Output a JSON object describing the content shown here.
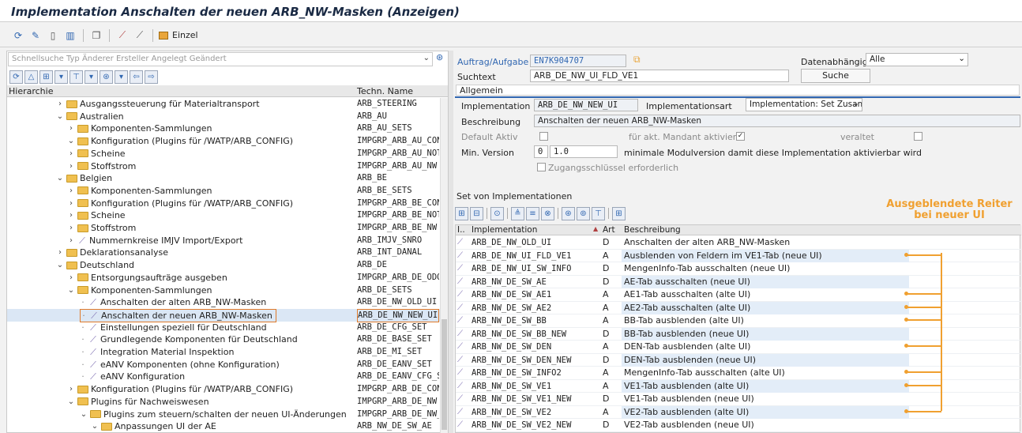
{
  "window": {
    "title": "Implementation Anschalten der neuen ARB_NW-Masken (Anzeigen)"
  },
  "toolbar": {
    "einzel_label": "Einzel"
  },
  "left": {
    "search_placeholder": "Schnellsuche Typ Änderer Ersteller Angelegt Geändert",
    "col_hierarchy": "Hierarchie",
    "col_tech": "Techn. Name",
    "rows": [
      {
        "label": "Ausgangssteuerung für Materialtransport",
        "tech": "ARB_STEERING"
      },
      {
        "label": "Australien",
        "tech": "ARB_AU"
      },
      {
        "label": "Komponenten-Sammlungen",
        "tech": "ARB_AU_SETS"
      },
      {
        "label": "Konfiguration (Plugins für /WATP/ARB_CONFIG)",
        "tech": "IMPGRP_ARB_AU_CON"
      },
      {
        "label": "Scheine",
        "tech": "IMPGRP_ARB_AU_NOT"
      },
      {
        "label": "Stoffstrom",
        "tech": "IMPGRP_ARB_AU_NW"
      },
      {
        "label": "Belgien",
        "tech": "ARB_BE"
      },
      {
        "label": "Komponenten-Sammlungen",
        "tech": "ARB_BE_SETS"
      },
      {
        "label": "Konfiguration (Plugins für /WATP/ARB_CONFIG)",
        "tech": "IMPGRP_ARB_BE_CONF"
      },
      {
        "label": "Scheine",
        "tech": "IMPGRP_ARB_BE_NOTI"
      },
      {
        "label": "Stoffstrom",
        "tech": "IMPGRP_ARB_BE_NW"
      },
      {
        "label": "Nummernkreise IMJV Import/Export",
        "tech": "ARB_IMJV_SNRO"
      },
      {
        "label": "Deklarationsanalyse",
        "tech": "ARB_INT_DANAL"
      },
      {
        "label": "Deutschland",
        "tech": "ARB_DE"
      },
      {
        "label": "Entsorgungsaufträge ausgeben",
        "tech": "IMPGRP_ARB_DE_ODO"
      },
      {
        "label": "Komponenten-Sammlungen",
        "tech": "ARB_DE_SETS"
      },
      {
        "label": "Anschalten der alten ARB_NW-Masken",
        "tech": "ARB_DE_NW_OLD_UI"
      },
      {
        "label": "Anschalten der neuen ARB_NW-Masken",
        "tech": "ARB_DE_NW_NEW_UI"
      },
      {
        "label": "Einstellungen speziell für Deutschland",
        "tech": "ARB_DE_CFG_SET"
      },
      {
        "label": "Grundlegende Komponenten für Deutschland",
        "tech": "ARB_DE_BASE_SET"
      },
      {
        "label": "Integration Material Inspektion",
        "tech": "ARB_DE_MI_SET"
      },
      {
        "label": "eANV Komponenten (ohne Konfiguration)",
        "tech": "ARB_DE_EANV_SET"
      },
      {
        "label": "eANV Konfiguration",
        "tech": "ARB_DE_EANV_CFG_SI"
      },
      {
        "label": "Konfiguration (Plugins für /WATP/ARB_CONFIG)",
        "tech": "IMPGRP_ARB_DE_CONI"
      },
      {
        "label": "Plugins für Nachweiswesen",
        "tech": "IMPGRP_ARB_DE_NW"
      },
      {
        "label": "Plugins zum steuern/schalten der neuen UI-Änderungen",
        "tech": "IMPGRP_ARB_DE_NW_"
      },
      {
        "label": "Anpassungen UI der AE",
        "tech": "ARB_NW_DE_SW_AE"
      }
    ]
  },
  "right": {
    "auftrag_label": "Auftrag/Aufgabe",
    "auftrag_value": "EN7K904707",
    "datenabh_label": "Datenabhängig",
    "datenabh_value": "Alle",
    "suchtext_label": "Suchtext",
    "suchtext_value": "ARB_DE_NW_UI_FLD_VE1",
    "suche_button": "Suche",
    "tab_allgemein": "Allgemein",
    "impl_label": "Implementation",
    "impl_value": "ARB_DE_NW_NEW_UI",
    "implart_label": "Implementationsart",
    "implart_value": "Implementation: Set Zusam...",
    "beschr_label": "Beschreibung",
    "beschr_value": "Anschalten der neuen ARB_NW-Masken",
    "default_label": "Default Aktiv",
    "akt_mandant_label": "für akt. Mandant aktiviert?",
    "veraltet_label": "veraltet",
    "minver_label": "Min. Version",
    "minver_a": "0",
    "minver_b": "1.0",
    "minver_text": "minimale Modulversion damit diese Implementation aktivierbar wird",
    "zugang_label": "Zugangsschlüssel erforderlich",
    "set_label": "Set von Implementationen",
    "col_i": "I..",
    "col_impl": "Implementation",
    "col_art": "Art",
    "col_beschr": "Beschreibung",
    "annotation": "Ausgeblendete Reiter bei neuer UI",
    "impls": [
      {
        "impl": "ARB_DE_NW_OLD_UI",
        "art": "D",
        "desc": "Anschalten der alten ARB_NW-Masken"
      },
      {
        "impl": "ARB_DE_NW_UI_FLD_VE1",
        "art": "A",
        "desc": "Ausblenden von Feldern im VE1-Tab (neue UI)"
      },
      {
        "impl": "ARB_DE_NW_UI_SW_INFO",
        "art": "D",
        "desc": "MengenInfo-Tab ausschalten (neue UI)"
      },
      {
        "impl": "ARB_NW_DE_SW_AE",
        "art": "D",
        "desc": "AE-Tab ausschalten (neue UI)"
      },
      {
        "impl": "ARB_NW_DE_SW_AE1",
        "art": "A",
        "desc": "AE1-Tab ausschalten (alte UI)"
      },
      {
        "impl": "ARB_NW_DE_SW_AE2",
        "art": "A",
        "desc": "AE2-Tab ausschalten (alte UI)"
      },
      {
        "impl": "ARB_NW_DE_SW_BB",
        "art": "A",
        "desc": "BB-Tab ausblenden (alte UI)"
      },
      {
        "impl": "ARB_NW_DE_SW_BB_NEW",
        "art": "D",
        "desc": "BB-Tab ausblenden (neue UI)"
      },
      {
        "impl": "ARB_NW_DE_SW_DEN",
        "art": "A",
        "desc": "DEN-Tab ausblenden (alte UI)"
      },
      {
        "impl": "ARB_NW_DE_SW_DEN_NEW",
        "art": "D",
        "desc": "DEN-Tab ausblenden (neue UI)"
      },
      {
        "impl": "ARB_NW_DE_SW_INFO2",
        "art": "A",
        "desc": "MengenInfo-Tab ausschalten (alte UI)"
      },
      {
        "impl": "ARB_NW_DE_SW_VE1",
        "art": "A",
        "desc": "VE1-Tab ausblenden (alte UI)"
      },
      {
        "impl": "ARB_NW_DE_SW_VE1_NEW",
        "art": "D",
        "desc": "VE1-Tab ausblenden (neue UI)"
      },
      {
        "impl": "ARB_NW_DE_SW_VE2",
        "art": "A",
        "desc": "VE2-Tab ausblenden (alte UI)"
      },
      {
        "impl": "ARB_NW_DE_SW_VE2_NEW",
        "art": "D",
        "desc": "VE2-Tab ausblenden (neue UI)"
      }
    ]
  },
  "colors": {
    "accent": "#3167b1",
    "annotation": "#f0a030",
    "selection": "#e07a2a"
  }
}
